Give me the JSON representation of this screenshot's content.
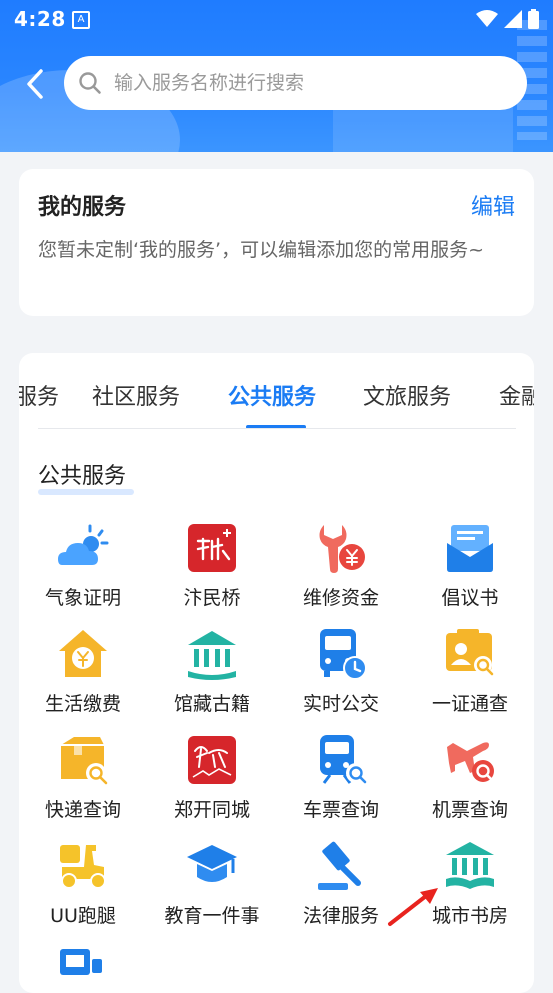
{
  "status_bar": {
    "time": "4:28",
    "notification_icon": "A"
  },
  "search": {
    "placeholder": "输入服务名称进行搜索"
  },
  "my_service": {
    "title": "我的服务",
    "edit_label": "编辑",
    "description": "您暂未定制‘我的服务’，可以编辑添加您的常用服务~"
  },
  "tabs": [
    "服务",
    "社区服务",
    "公共服务",
    "文旅服务",
    "金融"
  ],
  "active_tab": "公共服务",
  "section_title": "公共服务",
  "services": [
    {
      "label": "气象证明",
      "icon": "weather-icon"
    },
    {
      "label": "汴民桥",
      "icon": "bianminqiao-icon"
    },
    {
      "label": "维修资金",
      "icon": "repair-fund-icon"
    },
    {
      "label": "倡议书",
      "icon": "mail-icon"
    },
    {
      "label": "生活缴费",
      "icon": "home-payment-icon"
    },
    {
      "label": "馆藏古籍",
      "icon": "museum-icon"
    },
    {
      "label": "实时公交",
      "icon": "bus-icon"
    },
    {
      "label": "一证通查",
      "icon": "id-card-search-icon"
    },
    {
      "label": "快递查询",
      "icon": "package-search-icon"
    },
    {
      "label": "郑开同城",
      "icon": "zhengkai-icon"
    },
    {
      "label": "车票查询",
      "icon": "train-search-icon"
    },
    {
      "label": "机票查询",
      "icon": "plane-search-icon"
    },
    {
      "label": "UU跑腿",
      "icon": "scooter-icon"
    },
    {
      "label": "教育一件事",
      "icon": "graduation-cap-icon"
    },
    {
      "label": "法律服务",
      "icon": "gavel-icon"
    },
    {
      "label": "城市书房",
      "icon": "library-book-icon"
    }
  ],
  "colors": {
    "header": "#2a86ff",
    "accent": "#1b7cf4",
    "icon_blue": "#2f8cf0",
    "icon_orange": "#f5b52a",
    "icon_red": "#e8463e",
    "icon_teal": "#23b3a3"
  }
}
